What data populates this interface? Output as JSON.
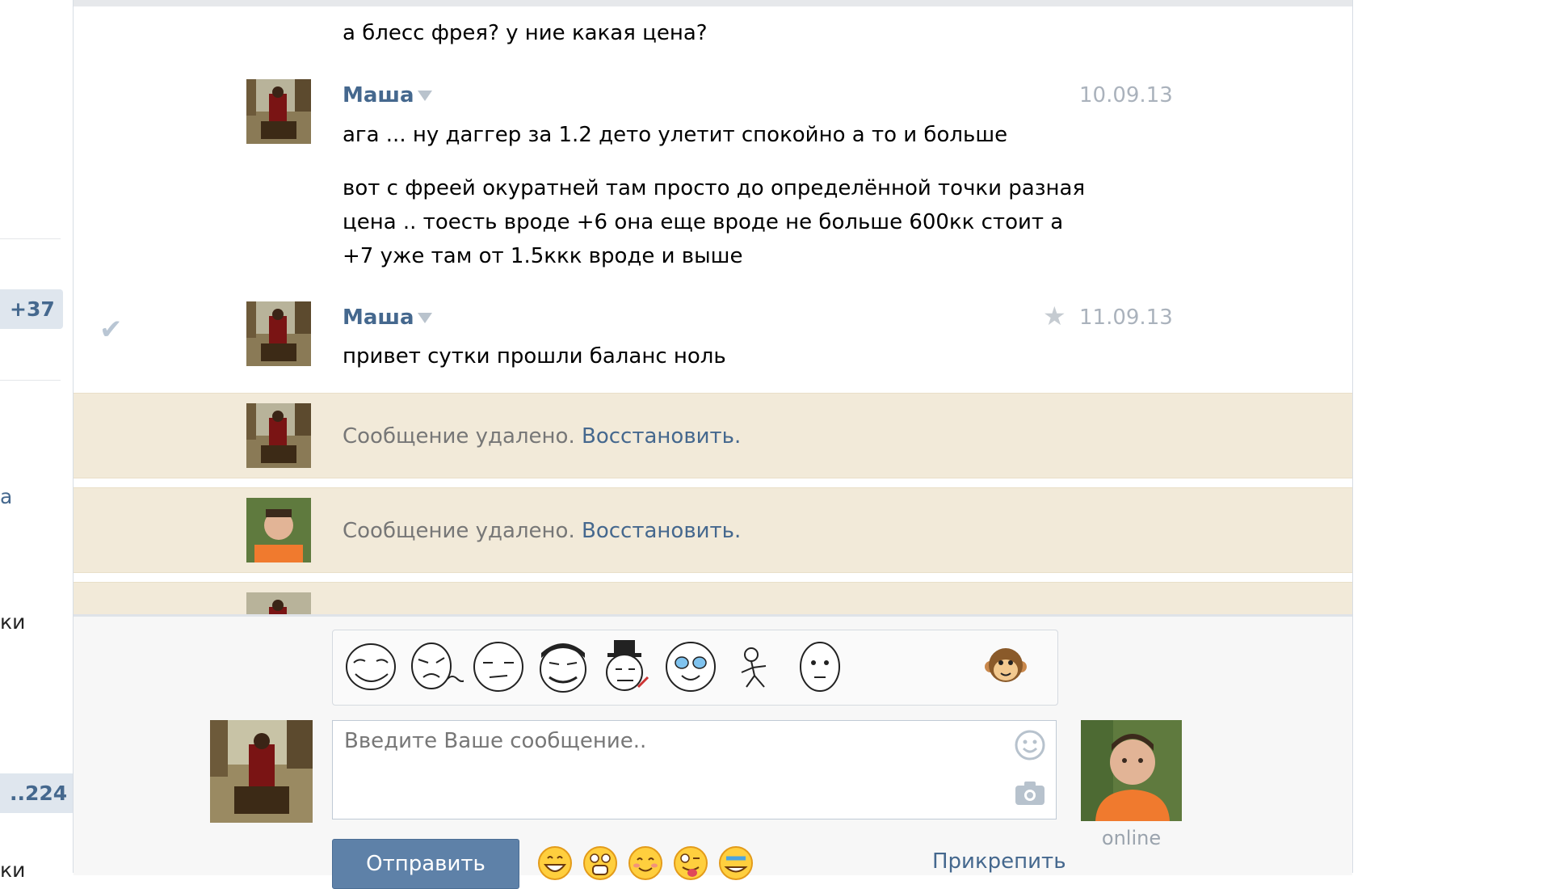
{
  "left_sidebar": {
    "badge_1": "+37",
    "badge_2": "..224",
    "fragment_1": "а",
    "fragment_2": "ки",
    "fragment_3": "ки"
  },
  "messages": {
    "prev_text": "а блесс фрея? у ние какая цена?",
    "msg1": {
      "author": "Маша",
      "date": "10.09.13",
      "line1": "ага ... ну даггер за 1.2 дето улетит спокойно а то и больше",
      "line2": "вот с фреей окуратней там просто до определённой точки разная",
      "line3": "цена .. тоесть вроде +6 она еще вроде не больше 600кк стоит а",
      "line4": "+7 уже там от 1.5ккк вроде и выше"
    },
    "msg2": {
      "author": "Маша",
      "date": "11.09.13",
      "text": "привет сутки прошли баланс ноль"
    },
    "deleted_1": {
      "text": "Сообщение удалено.",
      "restore": "Восстановить."
    },
    "deleted_2": {
      "text": "Сообщение удалено.",
      "restore": "Восстановить."
    }
  },
  "composer": {
    "placeholder": "Введите Ваше сообщение..",
    "value": "",
    "send_label": "Отправить",
    "attach_label": "Прикрепить",
    "peer_status": "online",
    "sticker_icons": [
      "troll-face-icon",
      "rage-face-icon",
      "meh-face-icon",
      "yao-ming-face-icon",
      "like-a-sir-icon",
      "happy-tears-face-icon",
      "stick-figure-icon",
      "poker-face-icon"
    ],
    "emoji_icons": [
      "grin-emoji-icon",
      "shocked-emoji-icon",
      "blush-emoji-icon",
      "wink-tongue-emoji-icon",
      "crying-emoji-icon"
    ]
  },
  "colors": {
    "link": "#45688e",
    "deleted_bg": "#f2ead9",
    "send_button": "#5e81a8"
  }
}
